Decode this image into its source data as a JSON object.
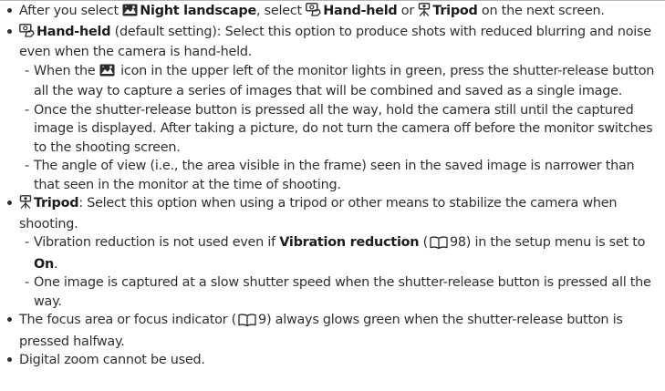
{
  "icons": {
    "night_landscape": "night-landscape-scene-icon",
    "hand_held": "hand-held-icon",
    "tripod": "tripod-icon",
    "page_reference": "book-reference-icon",
    "monitor_indicator_color": "#2e8b3d"
  },
  "bullet1": {
    "t1": "After you select ",
    "night_landscape": "Night landscape",
    "t2": ", select ",
    "hand_held": "Hand-held",
    "t3": " or ",
    "tripod": "Tripod",
    "t4": " on the next screen."
  },
  "bullet2": {
    "hand_held": "Hand-held",
    "text": " (default setting): Select this option to produce shots with reduced blurring and noise even when the camera is hand-held.",
    "sub1": {
      "t1": "When the ",
      "t2": " icon in the upper left of the monitor lights in green, press the shutter-release button all the way to capture a series of images that will be combined and saved as a single image."
    },
    "sub2": "Once the shutter-release button is pressed all the way, hold the camera still until the captured image is displayed. After taking a picture, do not turn the camera off before the monitor switches to the shooting screen.",
    "sub3": "The angle of view (i.e., the area visible in the frame) seen in the saved image is narrower than that seen in the monitor at the time of shooting."
  },
  "bullet3": {
    "tripod": "Tripod",
    "text": ": Select this option when using a tripod or other means to stabilize the camera when shooting.",
    "sub1": {
      "t1": "Vibration reduction is not used even if ",
      "vr": "Vibration reduction",
      "t2": " (",
      "page": "98",
      "t3": ") in the setup menu is set to ",
      "on": "On",
      "t4": "."
    },
    "sub2": "One image is captured at a slow shutter speed when the shutter-release button is pressed all the way."
  },
  "bullet4": {
    "t1": "The focus area or focus indicator (",
    "page": "9",
    "t2": ") always glows green when the shutter-release button is pressed halfway."
  },
  "bullet5": "Digital zoom cannot be used."
}
